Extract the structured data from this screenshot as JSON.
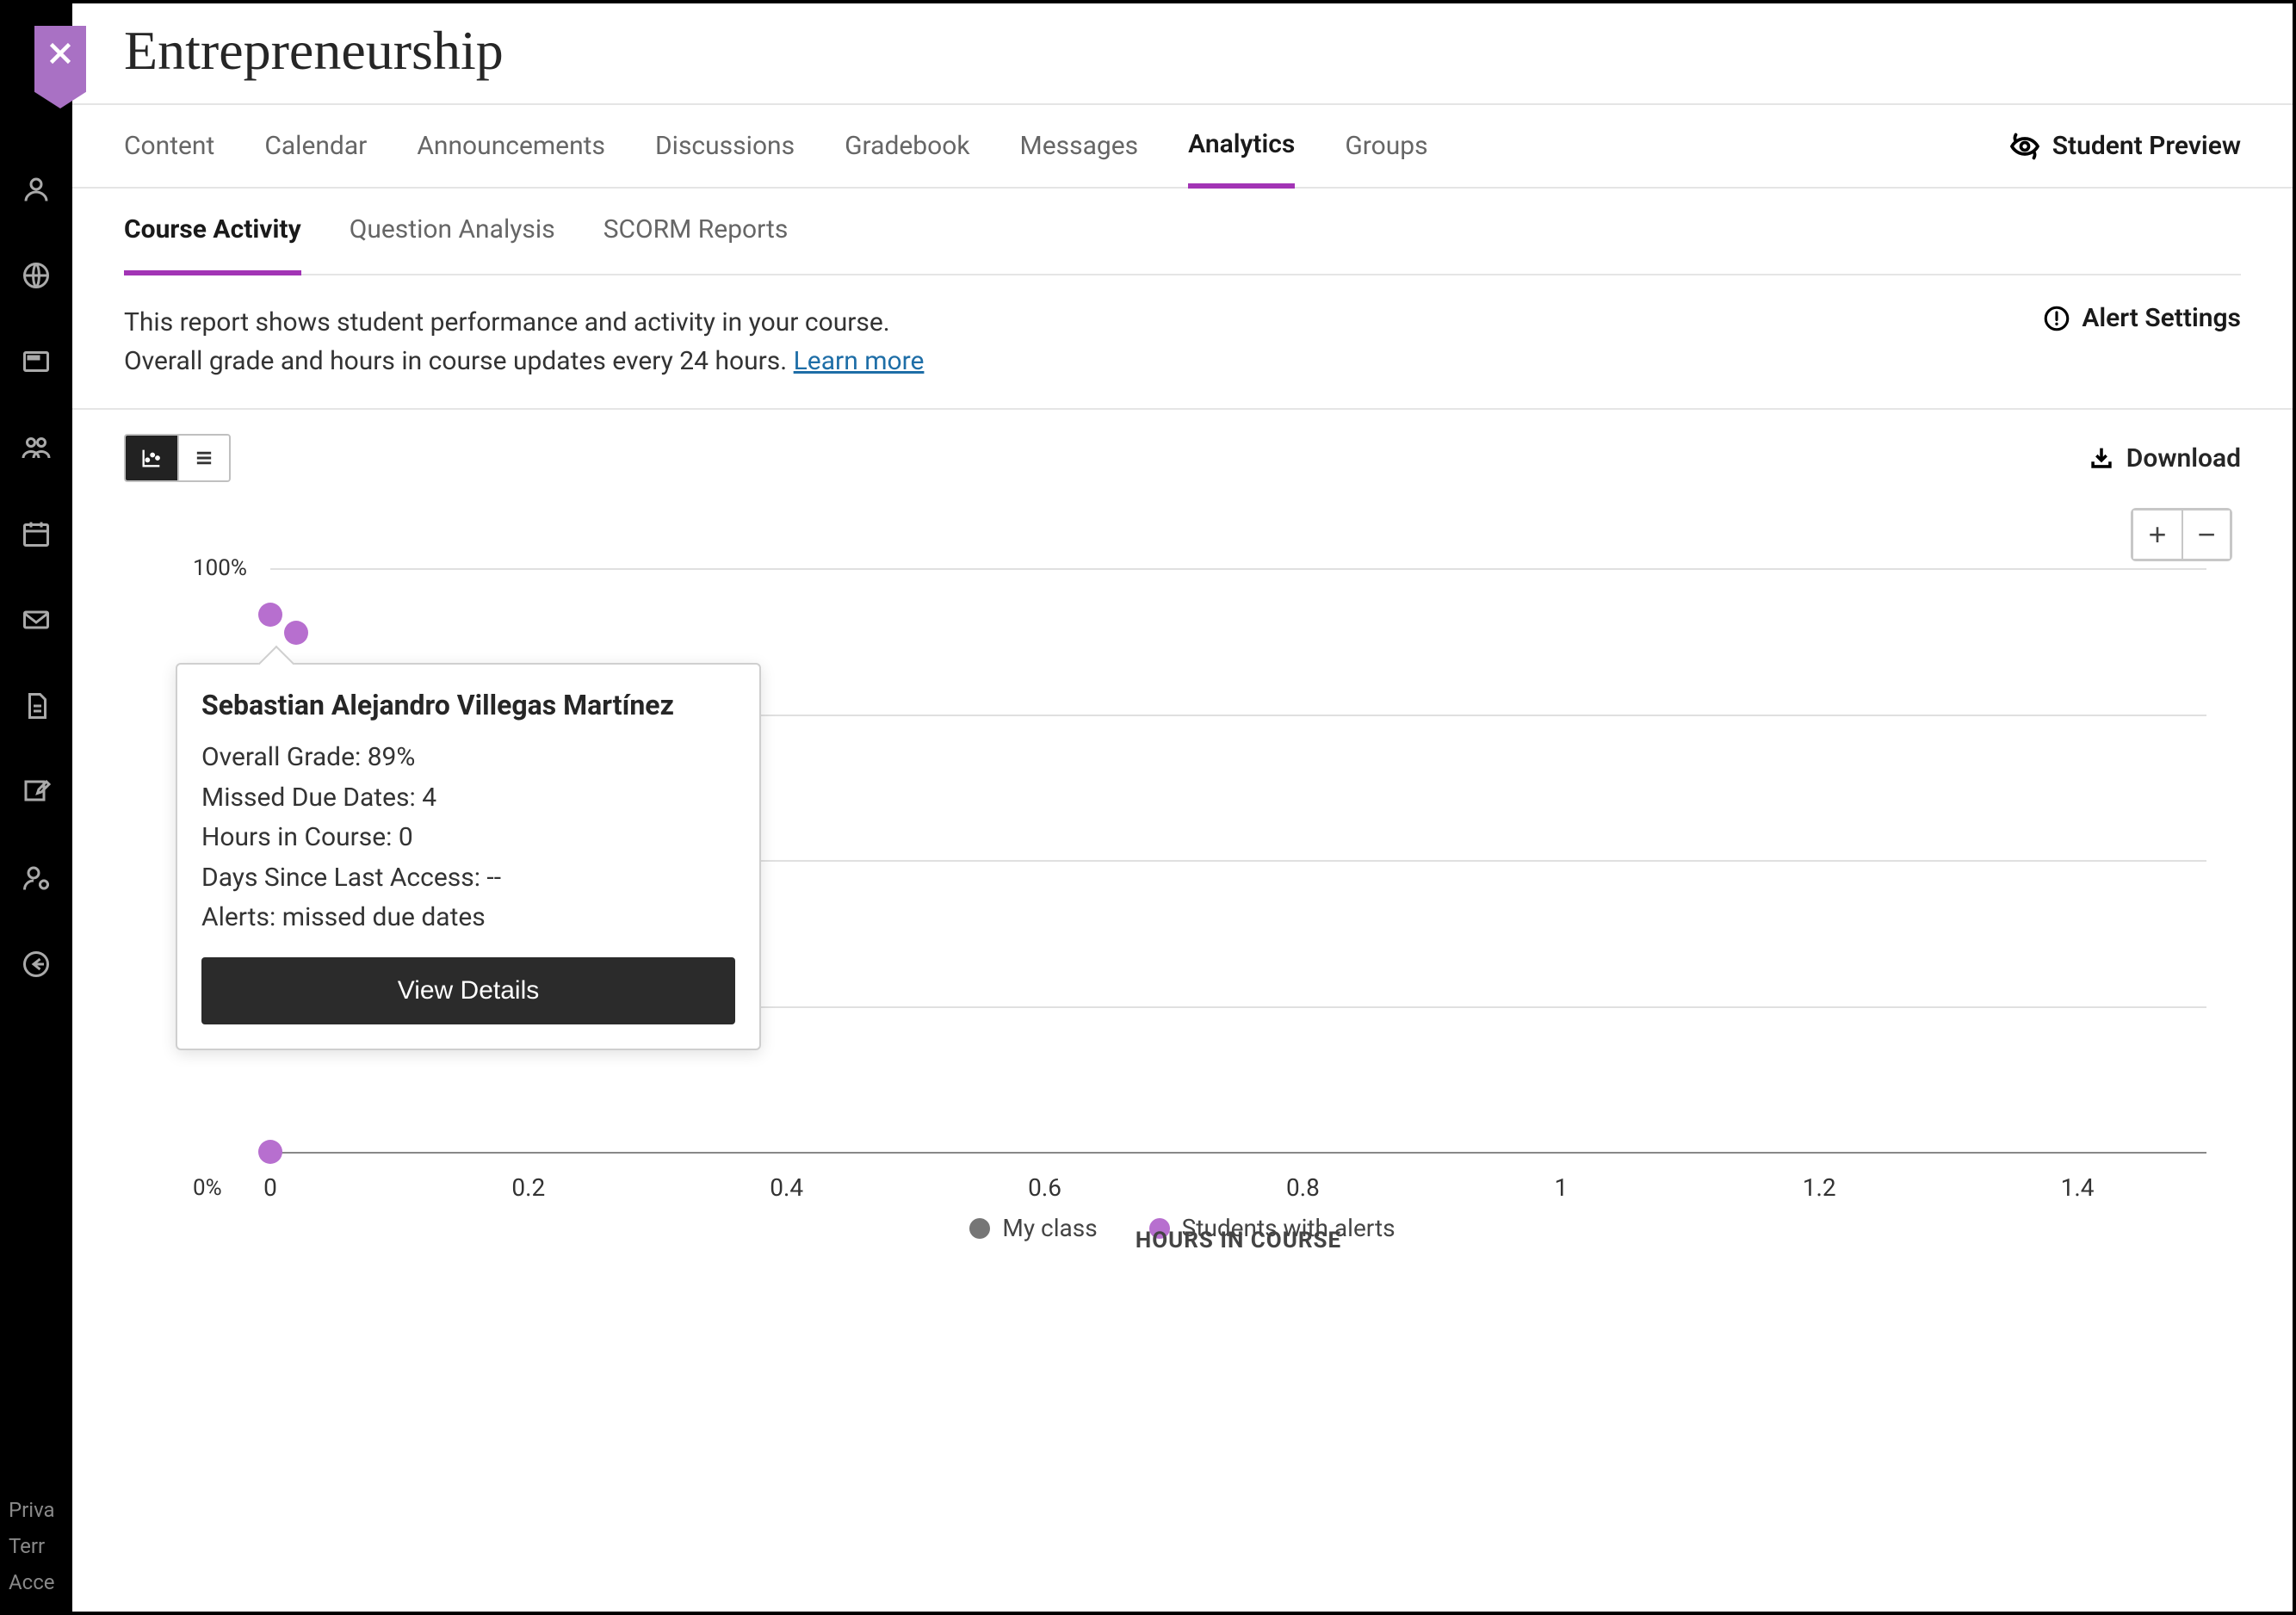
{
  "page_title": "Entrepreneurship",
  "primary_nav": {
    "items": [
      "Content",
      "Calendar",
      "Announcements",
      "Discussions",
      "Gradebook",
      "Messages",
      "Analytics",
      "Groups"
    ],
    "active": "Analytics",
    "student_preview": "Student Preview"
  },
  "sub_nav": {
    "items": [
      "Course Activity",
      "Question Analysis",
      "SCORM Reports"
    ],
    "active": "Course Activity"
  },
  "description": {
    "line1": "This report shows student performance and activity in your course.",
    "line2_prefix": "Overall grade and hours in course updates every 24 hours. ",
    "learn_more": "Learn more"
  },
  "alert_settings_label": "Alert Settings",
  "download_label": "Download",
  "chart_data": {
    "type": "scatter",
    "xlabel": "HOURS IN COURSE",
    "ylabel": "",
    "x_ticks": [
      0,
      0.2,
      0.4,
      0.6,
      0.8,
      1,
      1.2,
      1.4
    ],
    "y_ticks_labels": [
      "100%",
      "0%"
    ],
    "xlim": [
      0,
      1.5
    ],
    "ylim": [
      0,
      100
    ],
    "series": [
      {
        "name": "My class",
        "color": "#767676",
        "points": []
      },
      {
        "name": "Students with alerts",
        "color": "#b76fcf",
        "points": [
          {
            "x": 0.0,
            "y": 92
          },
          {
            "x": 0.02,
            "y": 89
          },
          {
            "x": 0.0,
            "y": 0
          }
        ]
      }
    ],
    "legend": [
      "My class",
      "Students with alerts"
    ]
  },
  "tooltip": {
    "name": "Sebastian Alejandro Villegas Martínez",
    "rows": {
      "overall_grade_label": "Overall Grade: ",
      "overall_grade_value": "89%",
      "missed_due_label": "Missed Due Dates: ",
      "missed_due_value": "4",
      "hours_label": "Hours in Course: ",
      "hours_value": "0",
      "days_label": "Days Since Last Access: ",
      "days_value": "--",
      "alerts_label": "Alerts: ",
      "alerts_value": "missed due dates"
    },
    "button": "View Details"
  },
  "rail_footer": [
    "Priva",
    "Terr",
    "Acce"
  ]
}
